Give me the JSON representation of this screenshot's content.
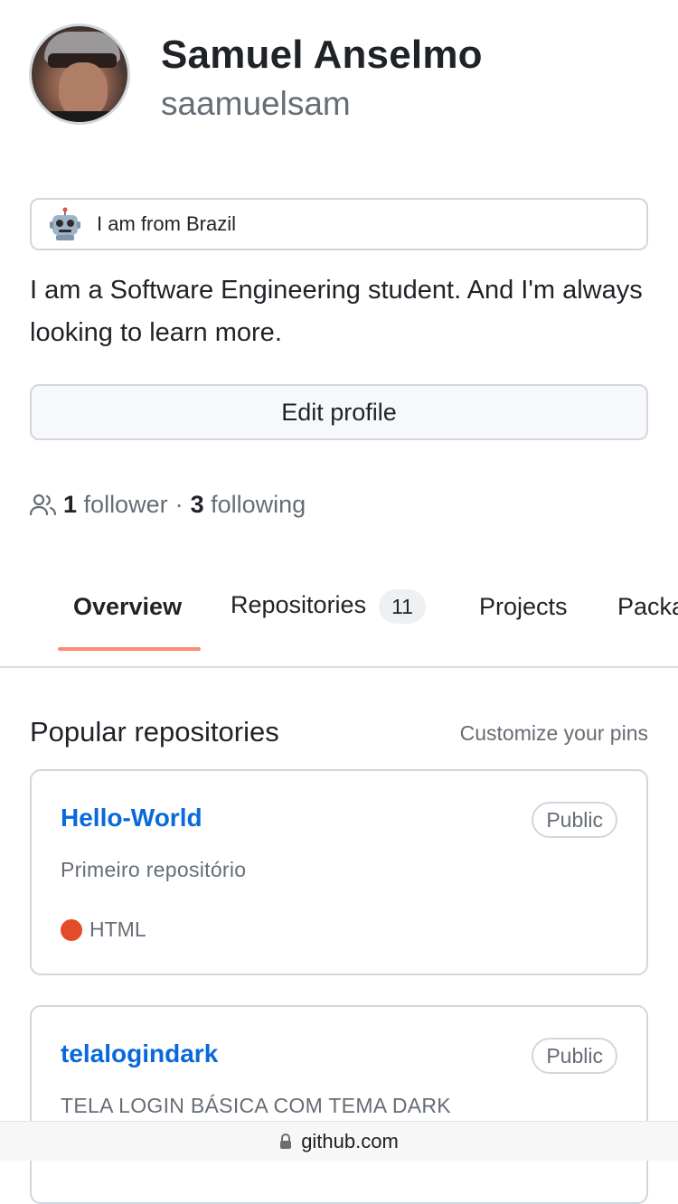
{
  "profile": {
    "name": "Samuel Anselmo",
    "login": "saamuelsam",
    "status": {
      "emoji_icon": "robot-icon",
      "text": "I am from Brazil"
    },
    "bio": "I am a Software Engineering student. And I'm always looking to learn more.",
    "edit_profile_label": "Edit profile",
    "followers_count": "1",
    "followers_label": "follower",
    "separator": "·",
    "following_count": "3",
    "following_label": "following"
  },
  "tabs": [
    {
      "label": "Overview",
      "selected": true
    },
    {
      "label": "Repositories",
      "counter": "11"
    },
    {
      "label": "Projects"
    },
    {
      "label": "Packa"
    }
  ],
  "popular": {
    "title": "Popular repositories",
    "customize_label": "Customize your pins",
    "repos": [
      {
        "name": "Hello-World",
        "visibility": "Public",
        "description": "Primeiro repositório",
        "language": "HTML",
        "language_color": "#e34c26"
      },
      {
        "name": "telalogindark",
        "visibility": "Public",
        "description": "TELA LOGIN BÁSICA COM TEMA DARK"
      }
    ]
  },
  "browser": {
    "url": "github.com"
  },
  "colors": {
    "link": "#0969da",
    "tab_underline": "#fd8c73",
    "border": "#d0d7de",
    "muted": "#656d76"
  }
}
